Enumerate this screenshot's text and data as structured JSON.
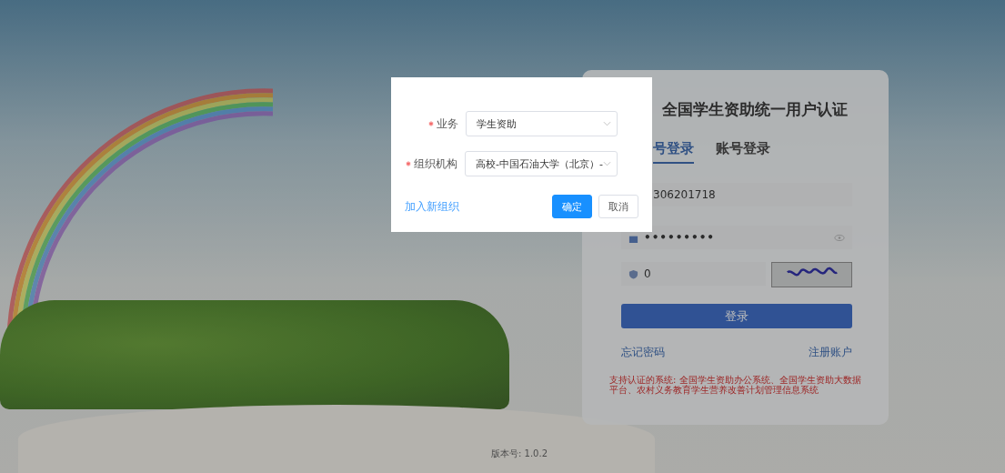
{
  "login_card": {
    "title": "全国学生资助统一用户认证",
    "tabs": [
      {
        "label": "号登录",
        "selected": true
      },
      {
        "label": "账号登录",
        "selected": false
      }
    ],
    "username": {
      "value": "306201718"
    },
    "password": {
      "value": "•••••••••"
    },
    "captcha": {
      "value": "0"
    },
    "login_button": "登录",
    "forgot_link": "忘记密码",
    "register_link": "注册账户",
    "notice": "支持认证的系统: 全国学生资助办公系统、全国学生资助大数据平台、农村义务教育学生营养改善计划管理信息系统"
  },
  "version": "版本号: 1.0.2",
  "dialog": {
    "fields": [
      {
        "label": "业务",
        "required": true,
        "value": "学生资助"
      },
      {
        "label": "组织机构",
        "required": true,
        "value": "高校-中国石油大学（北京）-"
      }
    ],
    "link": "加入新组织",
    "buttons": [
      {
        "label": "确定",
        "kind": "primary"
      },
      {
        "label": "取消",
        "kind": "default"
      }
    ]
  }
}
